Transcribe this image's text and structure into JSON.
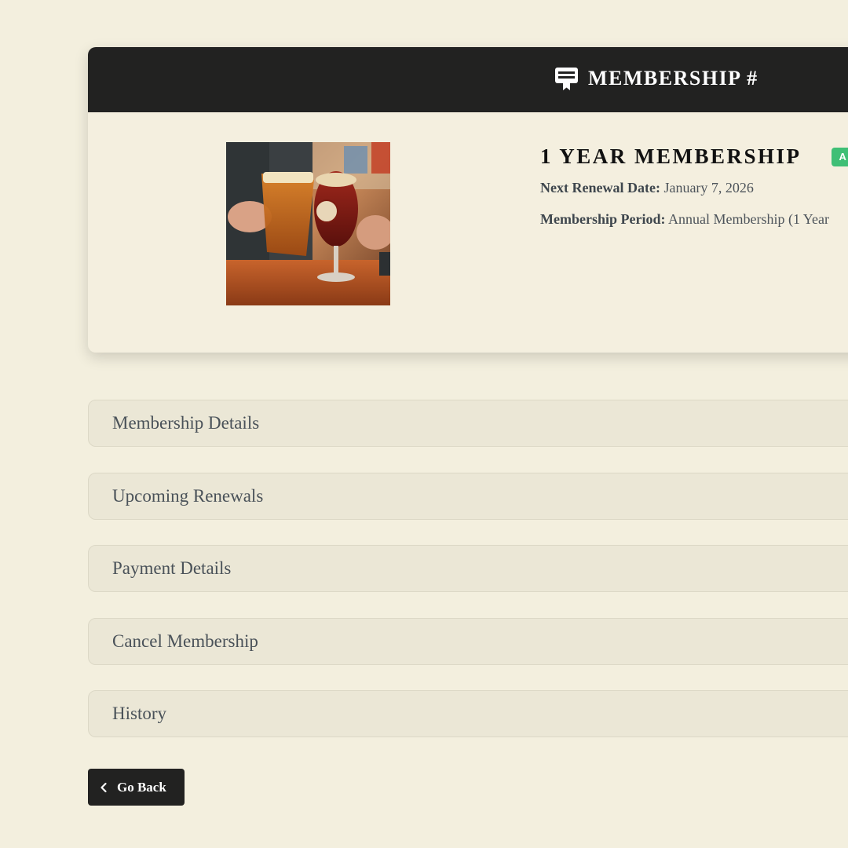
{
  "header": {
    "title": "MEMBERSHIP #",
    "icon": "certificate-icon"
  },
  "membership": {
    "title": "1 YEAR MEMBERSHIP",
    "status": "A",
    "status_color": "#3fbf76",
    "next_renewal_label": "Next Renewal Date:",
    "next_renewal_value": "January 7, 2026",
    "period_label": "Membership Period:",
    "period_value": "Annual Membership (1 Year"
  },
  "sections": [
    {
      "label": "Membership Details"
    },
    {
      "label": "Upcoming Renewals"
    },
    {
      "label": "Payment Details"
    },
    {
      "label": "Cancel Membership"
    },
    {
      "label": "History"
    }
  ],
  "footer": {
    "back_label": "Go Back",
    "back_icon": "chevron-left-icon"
  },
  "colors": {
    "background": "#f3efde",
    "header": "#222221",
    "accent_green": "#3fbf76"
  }
}
